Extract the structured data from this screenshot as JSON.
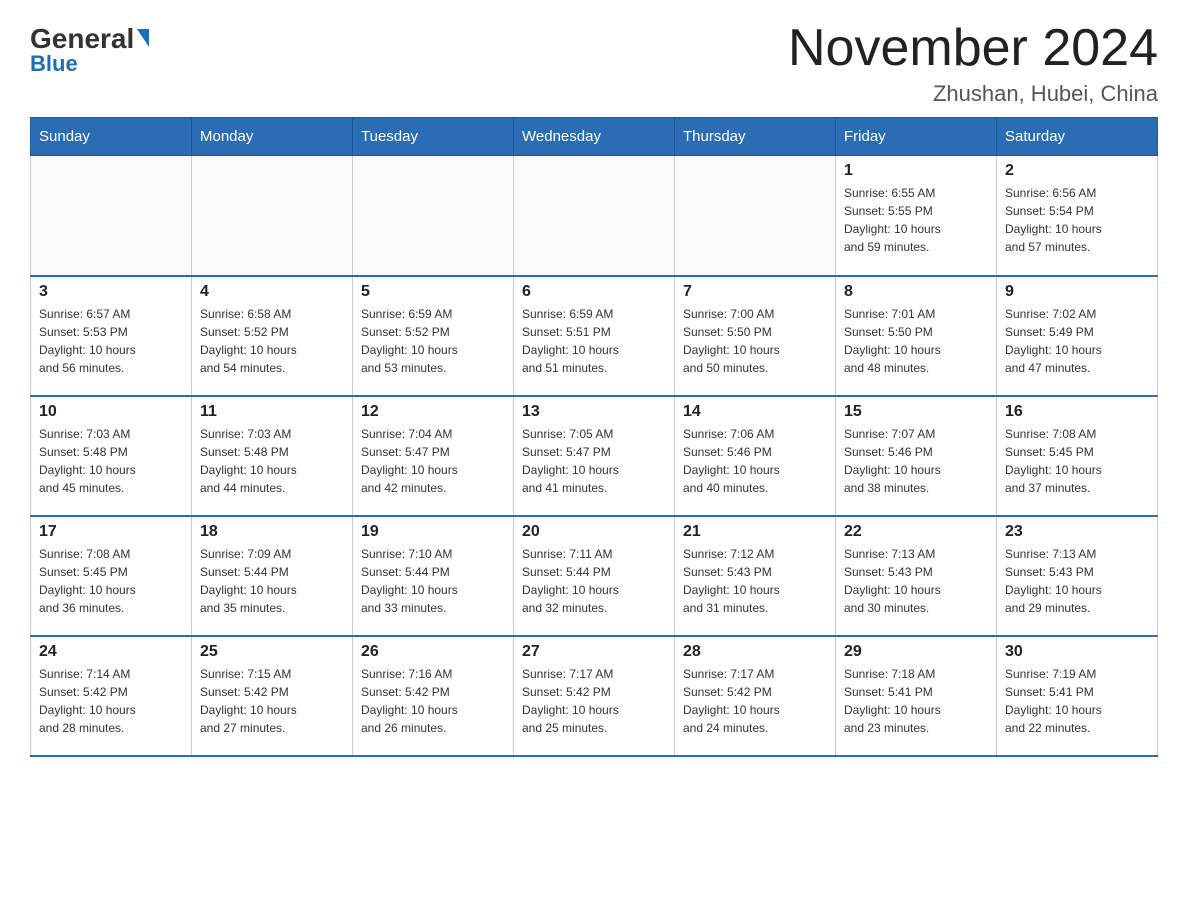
{
  "logo": {
    "general": "General",
    "blue": "Blue"
  },
  "title": "November 2024",
  "location": "Zhushan, Hubei, China",
  "days_of_week": [
    "Sunday",
    "Monday",
    "Tuesday",
    "Wednesday",
    "Thursday",
    "Friday",
    "Saturday"
  ],
  "weeks": [
    [
      {
        "day": "",
        "info": ""
      },
      {
        "day": "",
        "info": ""
      },
      {
        "day": "",
        "info": ""
      },
      {
        "day": "",
        "info": ""
      },
      {
        "day": "",
        "info": ""
      },
      {
        "day": "1",
        "info": "Sunrise: 6:55 AM\nSunset: 5:55 PM\nDaylight: 10 hours\nand 59 minutes."
      },
      {
        "day": "2",
        "info": "Sunrise: 6:56 AM\nSunset: 5:54 PM\nDaylight: 10 hours\nand 57 minutes."
      }
    ],
    [
      {
        "day": "3",
        "info": "Sunrise: 6:57 AM\nSunset: 5:53 PM\nDaylight: 10 hours\nand 56 minutes."
      },
      {
        "day": "4",
        "info": "Sunrise: 6:58 AM\nSunset: 5:52 PM\nDaylight: 10 hours\nand 54 minutes."
      },
      {
        "day": "5",
        "info": "Sunrise: 6:59 AM\nSunset: 5:52 PM\nDaylight: 10 hours\nand 53 minutes."
      },
      {
        "day": "6",
        "info": "Sunrise: 6:59 AM\nSunset: 5:51 PM\nDaylight: 10 hours\nand 51 minutes."
      },
      {
        "day": "7",
        "info": "Sunrise: 7:00 AM\nSunset: 5:50 PM\nDaylight: 10 hours\nand 50 minutes."
      },
      {
        "day": "8",
        "info": "Sunrise: 7:01 AM\nSunset: 5:50 PM\nDaylight: 10 hours\nand 48 minutes."
      },
      {
        "day": "9",
        "info": "Sunrise: 7:02 AM\nSunset: 5:49 PM\nDaylight: 10 hours\nand 47 minutes."
      }
    ],
    [
      {
        "day": "10",
        "info": "Sunrise: 7:03 AM\nSunset: 5:48 PM\nDaylight: 10 hours\nand 45 minutes."
      },
      {
        "day": "11",
        "info": "Sunrise: 7:03 AM\nSunset: 5:48 PM\nDaylight: 10 hours\nand 44 minutes."
      },
      {
        "day": "12",
        "info": "Sunrise: 7:04 AM\nSunset: 5:47 PM\nDaylight: 10 hours\nand 42 minutes."
      },
      {
        "day": "13",
        "info": "Sunrise: 7:05 AM\nSunset: 5:47 PM\nDaylight: 10 hours\nand 41 minutes."
      },
      {
        "day": "14",
        "info": "Sunrise: 7:06 AM\nSunset: 5:46 PM\nDaylight: 10 hours\nand 40 minutes."
      },
      {
        "day": "15",
        "info": "Sunrise: 7:07 AM\nSunset: 5:46 PM\nDaylight: 10 hours\nand 38 minutes."
      },
      {
        "day": "16",
        "info": "Sunrise: 7:08 AM\nSunset: 5:45 PM\nDaylight: 10 hours\nand 37 minutes."
      }
    ],
    [
      {
        "day": "17",
        "info": "Sunrise: 7:08 AM\nSunset: 5:45 PM\nDaylight: 10 hours\nand 36 minutes."
      },
      {
        "day": "18",
        "info": "Sunrise: 7:09 AM\nSunset: 5:44 PM\nDaylight: 10 hours\nand 35 minutes."
      },
      {
        "day": "19",
        "info": "Sunrise: 7:10 AM\nSunset: 5:44 PM\nDaylight: 10 hours\nand 33 minutes."
      },
      {
        "day": "20",
        "info": "Sunrise: 7:11 AM\nSunset: 5:44 PM\nDaylight: 10 hours\nand 32 minutes."
      },
      {
        "day": "21",
        "info": "Sunrise: 7:12 AM\nSunset: 5:43 PM\nDaylight: 10 hours\nand 31 minutes."
      },
      {
        "day": "22",
        "info": "Sunrise: 7:13 AM\nSunset: 5:43 PM\nDaylight: 10 hours\nand 30 minutes."
      },
      {
        "day": "23",
        "info": "Sunrise: 7:13 AM\nSunset: 5:43 PM\nDaylight: 10 hours\nand 29 minutes."
      }
    ],
    [
      {
        "day": "24",
        "info": "Sunrise: 7:14 AM\nSunset: 5:42 PM\nDaylight: 10 hours\nand 28 minutes."
      },
      {
        "day": "25",
        "info": "Sunrise: 7:15 AM\nSunset: 5:42 PM\nDaylight: 10 hours\nand 27 minutes."
      },
      {
        "day": "26",
        "info": "Sunrise: 7:16 AM\nSunset: 5:42 PM\nDaylight: 10 hours\nand 26 minutes."
      },
      {
        "day": "27",
        "info": "Sunrise: 7:17 AM\nSunset: 5:42 PM\nDaylight: 10 hours\nand 25 minutes."
      },
      {
        "day": "28",
        "info": "Sunrise: 7:17 AM\nSunset: 5:42 PM\nDaylight: 10 hours\nand 24 minutes."
      },
      {
        "day": "29",
        "info": "Sunrise: 7:18 AM\nSunset: 5:41 PM\nDaylight: 10 hours\nand 23 minutes."
      },
      {
        "day": "30",
        "info": "Sunrise: 7:19 AM\nSunset: 5:41 PM\nDaylight: 10 hours\nand 22 minutes."
      }
    ]
  ]
}
